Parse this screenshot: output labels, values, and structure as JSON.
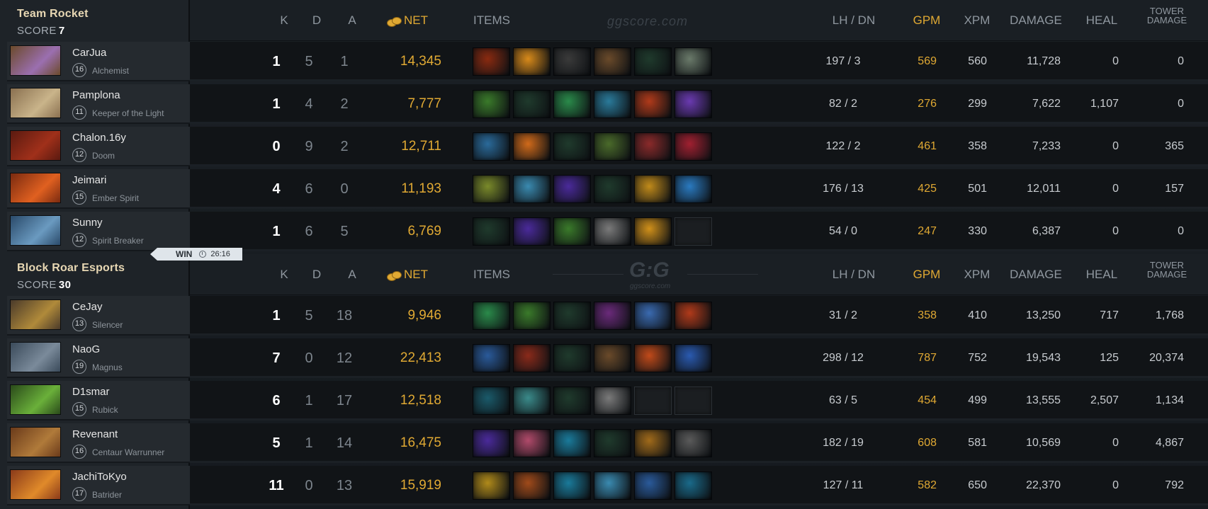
{
  "header": {
    "k": "K",
    "d": "D",
    "a": "A",
    "net": "NET",
    "items": "ITEMS",
    "lh_dn": "LH  /  DN",
    "gpm": "GPM",
    "xpm": "XPM",
    "damage": "DAMAGE",
    "heal": "HEAL",
    "tower_damage_1": "TOWER",
    "tower_damage_2": "DAMAGE",
    "watermark": "ggscore.com",
    "watermark_logo": "G:G",
    "watermark_logo_sub": "ggscore.com"
  },
  "win_badge": {
    "label": "WIN",
    "time": "26:16"
  },
  "teams": [
    {
      "name": "Team Rocket",
      "score_label": "SCORE",
      "score": "7",
      "players": [
        {
          "name": "CarJua",
          "level": "16",
          "hero": "Alchemist",
          "k": "1",
          "d": "5",
          "a": "1",
          "net": "14,345",
          "lh_dn": "197  /  3",
          "gpm": "569",
          "xpm": "560",
          "damage": "11,728",
          "heal": "0",
          "tower": "0",
          "avatar": [
            "#6b4a2a",
            "#9b6fb0"
          ],
          "items": [
            "#8a2a10",
            "#d88a1a",
            "#3a3a3a",
            "#6a4a2a",
            "#1f3a2c",
            "#6a7a6a"
          ]
        },
        {
          "name": "Pamplona",
          "level": "11",
          "hero": "Keeper of the Light",
          "k": "1",
          "d": "4",
          "a": "2",
          "net": "7,777",
          "lh_dn": "82  /  2",
          "gpm": "276",
          "xpm": "299",
          "damage": "7,622",
          "heal": "1,107",
          "tower": "0",
          "avatar": [
            "#8a7050",
            "#c9b48a"
          ],
          "items": [
            "#3a7a2a",
            "#1f3a2c",
            "#2a8a4a",
            "#2a7a9a",
            "#b03a1a",
            "#6a3ab0"
          ]
        },
        {
          "name": "Chalon.16y",
          "level": "12",
          "hero": "Doom",
          "k": "0",
          "d": "9",
          "a": "2",
          "net": "12,711",
          "lh_dn": "122  /  2",
          "gpm": "461",
          "xpm": "358",
          "damage": "7,233",
          "heal": "0",
          "tower": "365",
          "avatar": [
            "#5a1a10",
            "#a0301a"
          ],
          "items": [
            "#2a6a9a",
            "#d06a1a",
            "#1f3a2c",
            "#4a6a2a",
            "#8a2a2a",
            "#a02030"
          ]
        },
        {
          "name": "Jeimari",
          "level": "15",
          "hero": "Ember Spirit",
          "k": "4",
          "d": "6",
          "a": "0",
          "net": "11,193",
          "lh_dn": "176  /  13",
          "gpm": "425",
          "xpm": "501",
          "damage": "12,011",
          "heal": "0",
          "tower": "157",
          "avatar": [
            "#7a2a10",
            "#e06020"
          ],
          "items": [
            "#7a8a2a",
            "#3a8ab0",
            "#4a2a9a",
            "#1f3a2c",
            "#c08a1a",
            "#2a7ac0"
          ]
        },
        {
          "name": "Sunny",
          "level": "12",
          "hero": "Spirit Breaker",
          "k": "1",
          "d": "6",
          "a": "5",
          "net": "6,769",
          "lh_dn": "54  /  0",
          "gpm": "247",
          "xpm": "330",
          "damage": "6,387",
          "heal": "0",
          "tower": "0",
          "avatar": [
            "#2a4a6a",
            "#6a9ac0"
          ],
          "items": [
            "#1f3a2c",
            "#4a2a9a",
            "#3a7a2a",
            "#7a7a7a",
            "#d0901a",
            "empty"
          ]
        }
      ]
    },
    {
      "name": "Block Roar Esports",
      "score_label": "SCORE",
      "score": "30",
      "players": [
        {
          "name": "CeJay",
          "level": "13",
          "hero": "Silencer",
          "k": "1",
          "d": "5",
          "a": "18",
          "net": "9,946",
          "lh_dn": "31  /  2",
          "gpm": "358",
          "xpm": "410",
          "damage": "13,250",
          "heal": "717",
          "tower": "1,768",
          "avatar": [
            "#4a3a2a",
            "#b08a3a"
          ],
          "items": [
            "#2a8a4a",
            "#3a7a2a",
            "#1f3a2c",
            "#6a2a7a",
            "#3a6ab0",
            "#b03a1a"
          ]
        },
        {
          "name": "NaoG",
          "level": "19",
          "hero": "Magnus",
          "k": "7",
          "d": "0",
          "a": "12",
          "net": "22,413",
          "lh_dn": "298  /  12",
          "gpm": "787",
          "xpm": "752",
          "damage": "19,543",
          "heal": "125",
          "tower": "20,374",
          "avatar": [
            "#3a4a5a",
            "#7a8a9a"
          ],
          "items": [
            "#2a5a9a",
            "#8a2a1a",
            "#1f3a2c",
            "#6a4a2a",
            "#c04a1a",
            "#2a5ab0"
          ]
        },
        {
          "name": "D1smar",
          "level": "15",
          "hero": "Rubick",
          "k": "6",
          "d": "1",
          "a": "17",
          "net": "12,518",
          "lh_dn": "63  /  5",
          "gpm": "454",
          "xpm": "499",
          "damage": "13,555",
          "heal": "2,507",
          "tower": "1,134",
          "avatar": [
            "#2a4a1a",
            "#6ab03a"
          ],
          "items": [
            "#1a5a6a",
            "#3a8a8a",
            "#1f3a2c",
            "#7a7a7a",
            "empty",
            "empty"
          ]
        },
        {
          "name": "Revenant",
          "level": "16",
          "hero": "Centaur Warrunner",
          "k": "5",
          "d": "1",
          "a": "14",
          "net": "16,475",
          "lh_dn": "182  /  19",
          "gpm": "608",
          "xpm": "581",
          "damage": "10,569",
          "heal": "0",
          "tower": "4,867",
          "avatar": [
            "#6a3a1a",
            "#b07a3a"
          ],
          "items": [
            "#4a2a9a",
            "#b04a6a",
            "#1a7a9a",
            "#1f3a2c",
            "#a06a1a",
            "#5a5a5a"
          ]
        },
        {
          "name": "JachiToKyo",
          "level": "17",
          "hero": "Batrider",
          "k": "11",
          "d": "0",
          "a": "13",
          "net": "15,919",
          "lh_dn": "127  /  11",
          "gpm": "582",
          "xpm": "650",
          "damage": "22,370",
          "heal": "0",
          "tower": "792",
          "avatar": [
            "#8a3a1a",
            "#e08a2a"
          ],
          "items": [
            "#b08a1a",
            "#a04a1a",
            "#1a7a9a",
            "#3a8ab0",
            "#2a5a9a",
            "#1a6a8a"
          ]
        }
      ]
    }
  ]
}
